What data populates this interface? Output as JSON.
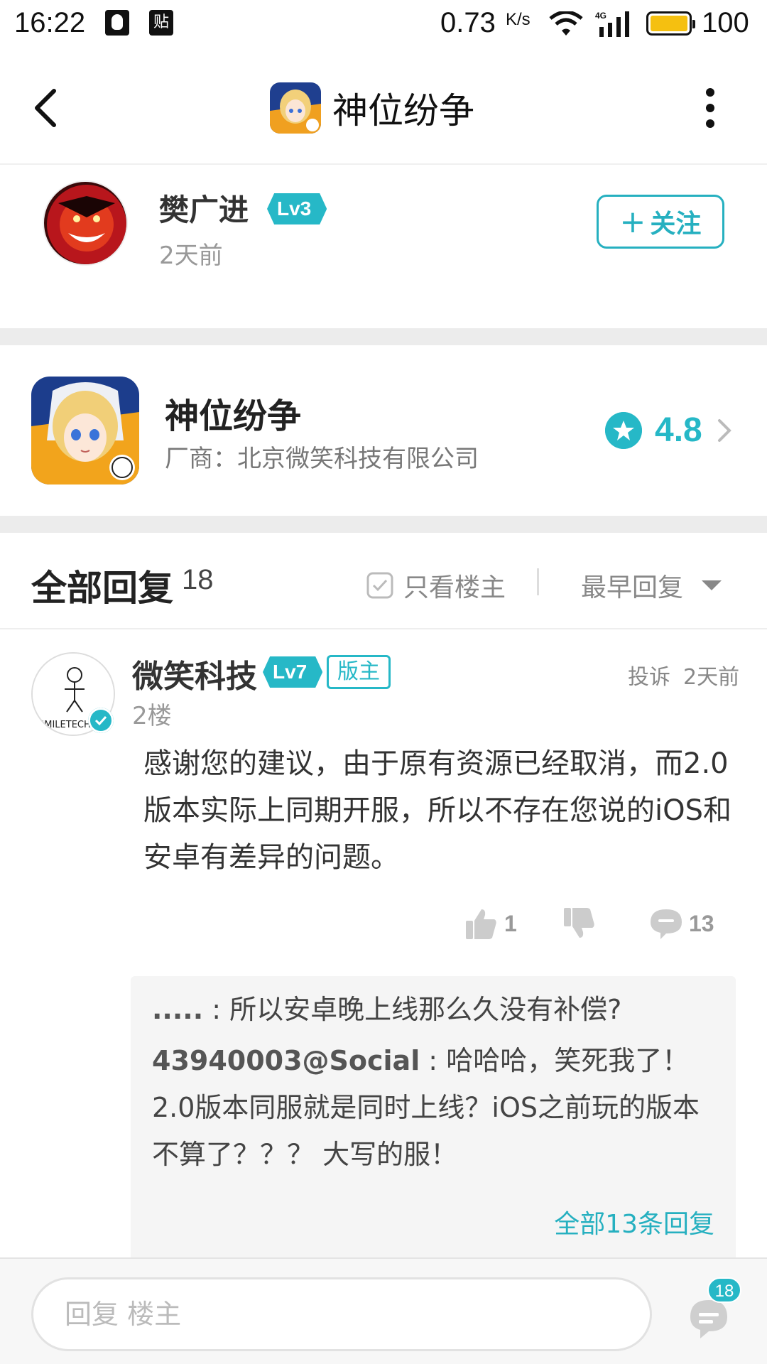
{
  "status_bar": {
    "time": "16:22",
    "notify_icons": [
      "qq-icon",
      "tieba-icon"
    ],
    "tie_glyph": "贴",
    "net_speed": "0.73",
    "net_speed_unit": "K/s",
    "network": "4G",
    "battery_level": "100"
  },
  "top_bar": {
    "title": "神位纷争"
  },
  "author": {
    "name": "樊广进",
    "level": "Lv3",
    "time": "2天前",
    "follow_label": "关注"
  },
  "game": {
    "name": "神位纷争",
    "vendor": "厂商：北京微笑科技有限公司",
    "rating": "4.8"
  },
  "replies": {
    "title": "全部回复",
    "count": "18",
    "only_op_label": "只看楼主",
    "sort_label": "最早回复"
  },
  "reply": {
    "name": "微笑科技",
    "level": "Lv7",
    "role_badge": "版主",
    "report_label": "投诉",
    "time": "2天前",
    "floor": "2楼",
    "avatar_text": "SMILETECH",
    "content": "感谢您的建议，由于原有资源已经取消，而2.0版本实际上同期开服，所以不存在您说的iOS和安卓有差异的问题。",
    "likes": "1",
    "comments": "13",
    "subreplies": [
      {
        "author": ".....",
        "sep": " : ",
        "text": "所以安卓晚上线那么久没有补偿?"
      },
      {
        "author": "43940003@Social",
        "sep": " : ",
        "text": "哈哈哈，笑死我了！2.0版本同服就是同时上线？iOS之前玩的版本不算了？？？ 大写的服！"
      }
    ],
    "view_all_label": "全部13条回复"
  },
  "bottom_bar": {
    "input_placeholder": "回复  楼主",
    "comment_count": "18"
  },
  "colors": {
    "accent": "#26b8c7",
    "divider": "#ececec",
    "battery": "#f5c010"
  }
}
